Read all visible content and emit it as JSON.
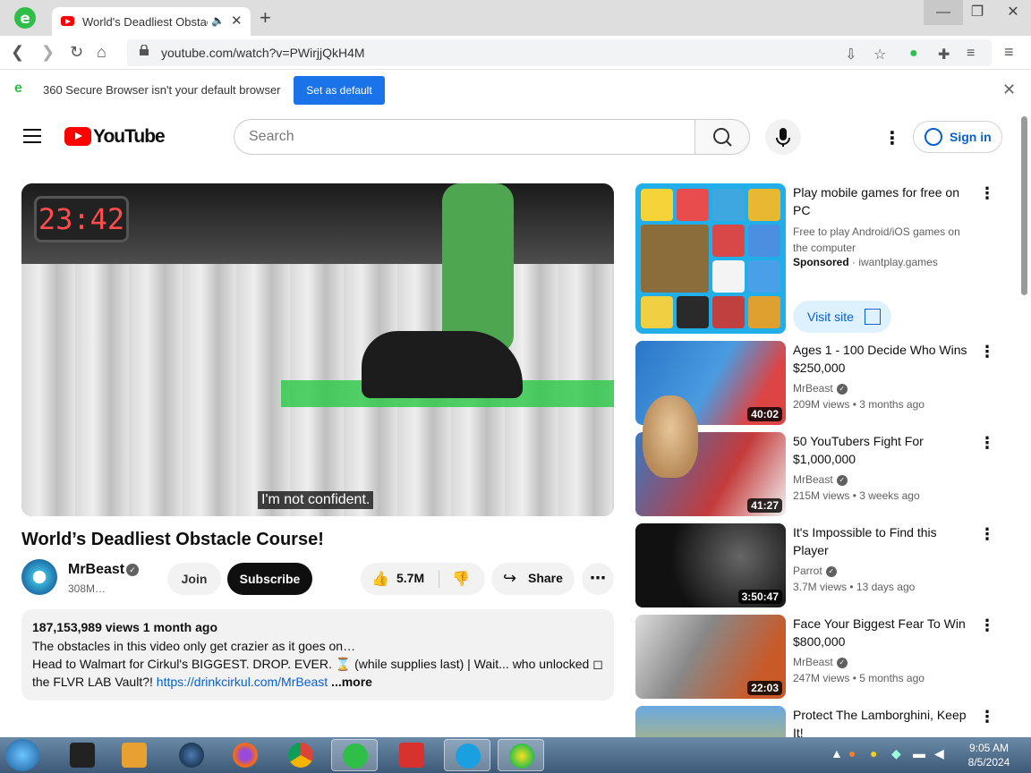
{
  "browser": {
    "tab_title": "World's Deadliest Obstacle Course! - YouTube",
    "url": "youtube.com/watch?v=PWirjjQkH4M",
    "infobar_message": "360 Secure Browser isn't your default browser",
    "set_default_label": "Set as default"
  },
  "youtube": {
    "logo_text": "YouTube",
    "search_placeholder": "Search",
    "signin_label": "Sign in"
  },
  "player": {
    "timer": "23:42",
    "caption": "I'm not confident."
  },
  "video": {
    "title": "World’s Deadliest Obstacle Course!",
    "channel": "MrBeast",
    "subscribers": "308M…",
    "join_label": "Join",
    "subscribe_label": "Subscribe",
    "likes": "5.7M",
    "share_label": "Share",
    "views_date": "187,153,989 views  1 month ago",
    "desc_line1": "The obstacles in this video only get crazier as it goes on…",
    "desc_line2": "Head to Walmart for Cirkul's BIGGEST. DROP. EVER. ⌛ (while supplies last)  | Wait... who unlocked ◻",
    "desc_line3_prefix": "the FLVR LAB Vault?! ",
    "desc_link": "https://drinkcirkul.com/MrBeast",
    "desc_more": " ...more"
  },
  "sidebar": {
    "ad": {
      "title": "Play mobile games for free on PC",
      "subtitle": "Free to play Android/iOS games on the computer",
      "sponsored": "Sponsored",
      "domain": " · iwantplay.games",
      "visit_label": "Visit site"
    },
    "recs": [
      {
        "title": "Ages 1 - 100 Decide Who Wins $250,000",
        "channel": "MrBeast",
        "views": "209M views",
        "age": "3 months ago",
        "duration": "40:02"
      },
      {
        "title": "50 YouTubers Fight For $1,000,000",
        "channel": "MrBeast",
        "views": "215M views",
        "age": "3 weeks ago",
        "duration": "41:27"
      },
      {
        "title": "It's Impossible to Find this Player",
        "channel": "Parrot",
        "views": "3.7M views",
        "age": "13 days ago",
        "duration": "3:50:47"
      },
      {
        "title": "Face Your Biggest Fear To Win $800,000",
        "channel": "MrBeast",
        "views": "247M views",
        "age": "5 months ago",
        "duration": "22:03"
      },
      {
        "title": "Protect The Lamborghini, Keep It!",
        "channel": "",
        "views": "",
        "age": "",
        "duration": ""
      }
    ]
  },
  "taskbar": {
    "time": "9:05 AM",
    "date": "8/5/2024"
  }
}
